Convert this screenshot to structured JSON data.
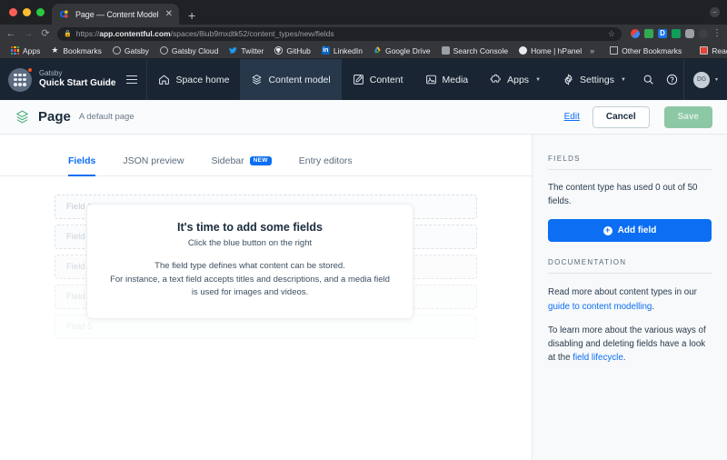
{
  "browser": {
    "tab": {
      "title": "Page — Content Model — Quic",
      "favicon_name": "contentful-favicon",
      "close_label": "✕"
    },
    "new_tab_label": "+",
    "nav": {
      "back_label": "←",
      "forward_label": "→",
      "reload_label": "⟳"
    },
    "omnibox": {
      "lock_icon": "lock-icon",
      "url_prefix": "https://",
      "url_host": "app.contentful.com",
      "url_path": "/spaces/8iub9mxdtk52/content_types/new/fields",
      "star_label": "☆"
    },
    "extensions": [
      {
        "name": "photos-extension",
        "color": "#ea4335"
      },
      {
        "name": "green-extension",
        "color": "#34a853"
      },
      {
        "name": "d-extension",
        "color": "#1a73e8"
      },
      {
        "name": "square-extension",
        "color": "#0f9d58"
      },
      {
        "name": "puzzle-extension",
        "color": "#9aa0a6"
      },
      {
        "name": "dark-extension",
        "color": "#3c4043"
      }
    ],
    "menu_label": "⋮",
    "bookmarks": [
      {
        "label": "Apps",
        "icon": "apps-grid-icon",
        "color": "#ea4335"
      },
      {
        "label": "Bookmarks",
        "icon": "star-icon",
        "color": "#e8eaed"
      },
      {
        "label": "Gatsby",
        "icon": "gatsby-icon",
        "color": "#b8bcc0"
      },
      {
        "label": "Gatsby Cloud",
        "icon": "gatsby-cloud-icon",
        "color": "#b8bcc0"
      },
      {
        "label": "Twitter",
        "icon": "twitter-icon",
        "color": "#1d9bf0"
      },
      {
        "label": "GitHub",
        "icon": "github-icon",
        "color": "#e8eaed"
      },
      {
        "label": "LinkedIn",
        "icon": "linkedin-icon",
        "color": "#0a66c2"
      },
      {
        "label": "Google Drive",
        "icon": "google-drive-icon",
        "color": "#fbbc04"
      },
      {
        "label": "Search Console",
        "icon": "search-console-icon",
        "color": "#9aa0a6"
      },
      {
        "label": "Home | hPanel",
        "icon": "hpanel-icon",
        "color": "#e8eaed"
      }
    ],
    "bookmarks_overflow_label": "»",
    "other_bookmarks": {
      "label": "Other Bookmarks",
      "icon": "folder-icon"
    },
    "reading_list": {
      "label": "Reading List",
      "icon": "reading-list-icon"
    },
    "window_minimize_label": "−"
  },
  "topnav": {
    "space": {
      "org": "Gatsby",
      "name": "Quick Start Guide",
      "logo_name": "space-logo",
      "menu_name": "space-menu-icon"
    },
    "items": [
      {
        "label": "Space home",
        "icon": "home-icon",
        "active": false,
        "caret": false
      },
      {
        "label": "Content model",
        "icon": "content-model-icon",
        "active": true,
        "caret": false
      },
      {
        "label": "Content",
        "icon": "content-icon",
        "active": false,
        "caret": false
      },
      {
        "label": "Media",
        "icon": "media-icon",
        "active": false,
        "caret": false
      },
      {
        "label": "Apps",
        "icon": "apps-puzzle-icon",
        "active": false,
        "caret": true
      },
      {
        "label": "Settings",
        "icon": "gear-icon",
        "active": false,
        "caret": true
      }
    ],
    "search_icon": "search-icon",
    "help_icon": "help-icon",
    "user": {
      "initials": "DG",
      "caret": "▾"
    }
  },
  "pagebar": {
    "icon_name": "content-type-icon",
    "title": "Page",
    "description": "A default page",
    "edit_label": "Edit",
    "cancel_label": "Cancel",
    "save_label": "Save"
  },
  "tabs": [
    {
      "label": "Fields",
      "active": true,
      "badge": null
    },
    {
      "label": "JSON preview",
      "active": false,
      "badge": null
    },
    {
      "label": "Sidebar",
      "active": false,
      "badge": "NEW"
    },
    {
      "label": "Entry editors",
      "active": false,
      "badge": null
    }
  ],
  "ghost_fields": [
    "Field 1",
    "Field 2",
    "Field 3",
    "Field 4",
    "Field 5"
  ],
  "overlay": {
    "title": "It's time to add some fields",
    "subtitle": "Click the blue button on the right",
    "body_line1": "The field type defines what content can be stored.",
    "body_line2": "For instance, a text field accepts titles and descriptions, and a media field is used for images and videos."
  },
  "sidebar": {
    "fields_heading": "FIELDS",
    "usage_text": "The content type has used 0 out of 50 fields.",
    "add_field_label": "Add field",
    "documentation_heading": "DOCUMENTATION",
    "doc_para1_pre": "Read more about content types in our ",
    "doc_para1_link": "guide to content modelling",
    "doc_para1_post": ".",
    "doc_para2_pre": "To learn more about the various ways of disabling and deleting fields have a look at the ",
    "doc_para2_link": "field lifecycle",
    "doc_para2_post": "."
  },
  "colors": {
    "accent_blue": "#0b6ef3",
    "nav_dark": "#192532",
    "nav_active": "#27384a",
    "save_green": "#8cc8a4"
  }
}
